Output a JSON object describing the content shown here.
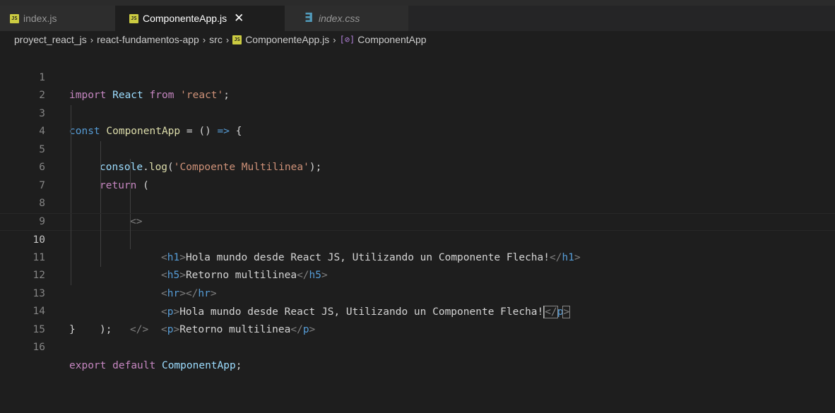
{
  "tabs": [
    {
      "icon": "js-file-icon",
      "badge": "JS",
      "label": "index.js",
      "active": false
    },
    {
      "icon": "js-file-icon",
      "badge": "JS",
      "label": "ComponenteApp.js",
      "active": true,
      "close": "✕"
    },
    {
      "icon": "css-file-icon",
      "badge": "∃",
      "label": "index.css",
      "active": false
    }
  ],
  "breadcrumb": {
    "items": [
      "proyect_react_js",
      "react-fundamentos-app",
      "src",
      "ComponenteApp.js",
      "ComponentApp"
    ],
    "separator": "›",
    "file_badge": "JS",
    "symbol_icon": "[⊘]"
  },
  "editor": {
    "current_line": 10,
    "line_numbers": [
      "1",
      "2",
      "3",
      "4",
      "5",
      "6",
      "7",
      "8",
      "9",
      "10",
      "11",
      "12",
      "13",
      "14",
      "15",
      "16"
    ],
    "code": {
      "l1": {
        "k": "import",
        "v": " React ",
        "k2": "from",
        "s": "'react'",
        "p": ";"
      },
      "l3": {
        "k": "const",
        "v": " ComponentApp ",
        "op": "= () ",
        "arrow": "=>",
        "brace": " {"
      },
      "l4": {
        "obj": "console",
        "dot": ".",
        "fn": "log",
        "open": "(",
        "s": "'Compoente Multilinea'",
        "close": ");"
      },
      "l5": {
        "k": "return",
        "open": " ("
      },
      "l6": {
        "tag": "<>"
      },
      "l7": {
        "lt": "<",
        "tag": "h1",
        "gt": ">",
        "text": "Hola mundo desde React JS, Utilizando un Componente Flecha!",
        "clt": "</",
        "ctag": "h1",
        "cgt": ">"
      },
      "l8": {
        "lt": "<",
        "tag": "h5",
        "gt": ">",
        "text": "Retorno multilinea",
        "clt": "</",
        "ctag": "h5",
        "cgt": ">"
      },
      "l9": {
        "lt": "<",
        "tag": "hr",
        "gt": ">",
        "clt": "</",
        "ctag": "hr",
        "cgt": ">"
      },
      "l10": {
        "lt": "<",
        "tag": "p",
        "gt": ">",
        "text": "Hola mundo desde React JS, Utilizando un Componente Flecha!",
        "clt": "</",
        "ctag": "p",
        "cgt": ">"
      },
      "l11": {
        "lt": "<",
        "tag": "p",
        "gt": ">",
        "text": "Retorno multilinea",
        "clt": "</",
        "ctag": "p",
        "cgt": ">"
      },
      "l12": {
        "tag": "</>"
      },
      "l13": {
        "p": ");"
      },
      "l14": {
        "p": "}"
      },
      "l16": {
        "k": "export",
        "sp": " ",
        "k2": "default",
        "v": " ComponentApp",
        "p": ";"
      }
    }
  },
  "colors": {
    "background": "#1e1e1e",
    "keyword": "#569cd6",
    "control": "#c586c0",
    "string": "#ce9178",
    "function": "#dcdcaa",
    "variable": "#9cdcfe"
  }
}
